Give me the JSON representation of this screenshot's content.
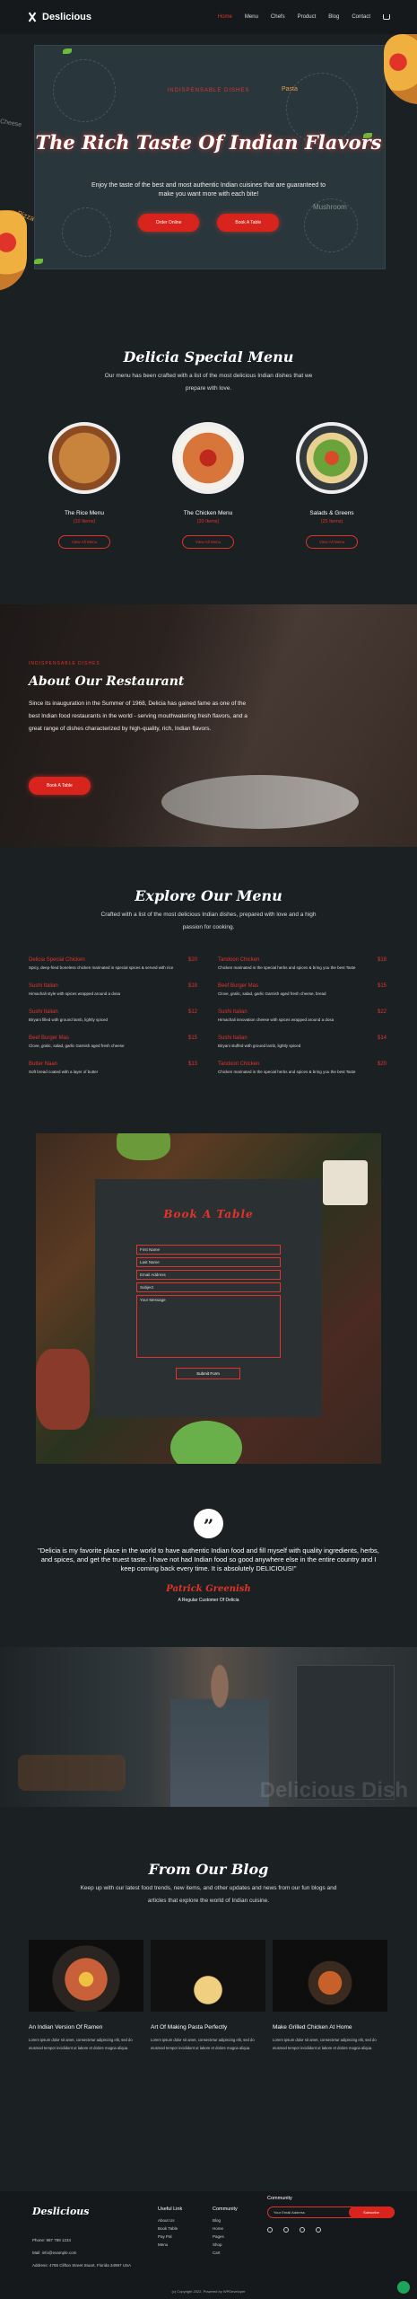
{
  "brand": "Deslicious",
  "nav": [
    "Home",
    "Menu",
    "Chefs",
    "Product",
    "Blog",
    "Contact"
  ],
  "hero": {
    "eyebrow": "INDISPENSABLE DISHES",
    "title": "The Rich Taste Of Indian Flavors",
    "subtitle": "Enjoy the taste of the best and most authentic Indian cuisines that are guaranteed to make you want more with each bite!",
    "btn_order": "Order Online",
    "btn_book": "Book A Table",
    "doodle_labels": [
      "Pasta",
      "Cheese",
      "Mushroom",
      "Pizza"
    ]
  },
  "special": {
    "title": "Delicia Special Menu",
    "subtitle": "Our menu has been crafted with a list of the most delicious Indian dishes that we prepare with love.",
    "dishes": [
      {
        "name": "The Rice Menu",
        "price": "(10 Items)",
        "button": "View All Menu",
        "color": "#b26a2c"
      },
      {
        "name": "The Chicken Menu",
        "price": "(20 Items)",
        "button": "View All Menu",
        "color": "#c2402a"
      },
      {
        "name": "Salads & Greens",
        "price": "(25 Items)",
        "button": "View All Menu",
        "color": "#6aa33a"
      }
    ]
  },
  "about": {
    "eyebrow": "INDISPENSABLE DISHES",
    "title": "About Our Restaurant",
    "text": "Since its inauguration in the Summer of 1968, Delicia has gained fame as one of the best Indian food restaurants in the world - serving mouthwatering fresh flavors, and a great range of dishes characterized by high-quality, rich, Indian flavors.",
    "button": "Book A Table"
  },
  "explore": {
    "title": "Explore Our Menu",
    "subtitle": "Crafted with a list of the most delicious Indian dishes, prepared with love and a high passion for cooking.",
    "left": [
      {
        "name": "Delicia Special Chicken",
        "price": "$20",
        "desc": "Spicy, deep-fried boneless chicken marinated in special spices & served with rice"
      },
      {
        "name": "Sushi Italian",
        "price": "$18",
        "desc": "Himachali style with spices wrapped around a dosa"
      },
      {
        "name": "Sushi Italian",
        "price": "$12",
        "desc": "Biryani filled with ground lamb, lightly spiced"
      },
      {
        "name": "Beef Burger Mas",
        "price": "$15",
        "desc": "Clove, gralic, salad, garlic Garnish aged fresh cheese"
      },
      {
        "name": "Butter Naan",
        "price": "$13",
        "desc": "Soft bread coated with a layer of butter"
      }
    ],
    "right": [
      {
        "name": "Tandoori Chicken",
        "price": "$18",
        "desc": "Chicken marinated in the special herbs and spices & bring you the best Taste"
      },
      {
        "name": "Beef Burger Mas",
        "price": "$15",
        "desc": "Clove, gralic, salad, garlic Garnish aged fresh cheese, bread"
      },
      {
        "name": "Sushi Italian",
        "price": "$22",
        "desc": "Himachali innovation cheese with spices wrapped around a dosa"
      },
      {
        "name": "Sushi Italian",
        "price": "$14",
        "desc": "Biryani stuffed with ground lamb, lightly spiced"
      },
      {
        "name": "Tandoori Chicken",
        "price": "$20",
        "desc": "Chicken marinated in the special herbs and spices & bring you the best Taste"
      }
    ]
  },
  "book": {
    "title": "Book A Table",
    "fields": [
      "First Name",
      "Last Name",
      "Email Address",
      "Subject",
      "Your Message"
    ],
    "submit": "Submit Form"
  },
  "testimonial": {
    "quote": "\"Delicia is my favorite place in the world to have authentic Indian food and fill myself with quality ingredients, herbs, and spices, and get the truest taste. I have not had Indian food so good anywhere else in the entire country and I keep coming back every time. It is absolutely DELICIOUS!\"",
    "name": "Patrick Greenish",
    "role": "A Regular Customer Of Delicia"
  },
  "chef_watermark": "Delicious Dish",
  "blog": {
    "title": "From Our Blog",
    "subtitle": "Keep up with our latest food trends, new items, and other updates and news from our fun blogs and articles that explore the world of Indian cuisine.",
    "posts": [
      {
        "title": "An Indian Version Of Ramen",
        "text": "Lorem ipsum dolor sit amet, consectetur adipiscing elit, sed do eiusmod tempor incididunt ut labore et dolore magna aliqua."
      },
      {
        "title": "Art Of Making Pasta Perfectly",
        "text": "Lorem ipsum dolor sit amet, consectetur adipiscing elit, sed do eiusmod tempor incididunt ut labore et dolore magna aliqua."
      },
      {
        "title": "Make Grilled Chicken At Home",
        "text": "Lorem ipsum dolor sit amet, consectetur adipiscing elit, sed do eiusmod tempor incididunt ut labore et dolore magna aliqua."
      }
    ]
  },
  "footer": {
    "logo": "Deslicious",
    "phone": "Phone: 987 789 1234",
    "email": "Mail: info@example.com",
    "address": "Address: 4765 Clifton Street Stuart, Florida 34997 USA",
    "useful_title": "Useful Link",
    "useful": [
      "About Us",
      "Book Table",
      "Pay Pal",
      "Menu"
    ],
    "community_title": "Community",
    "community": [
      "Blog",
      "Home",
      "Pages",
      "Shop",
      "Cart"
    ],
    "newsletter_title": "Community",
    "subscribe_placeholder": "Your Email Address",
    "subscribe_btn": "Subscribe",
    "copyright": "(c) Copyright 2022, Powered by WPDeveloper"
  }
}
